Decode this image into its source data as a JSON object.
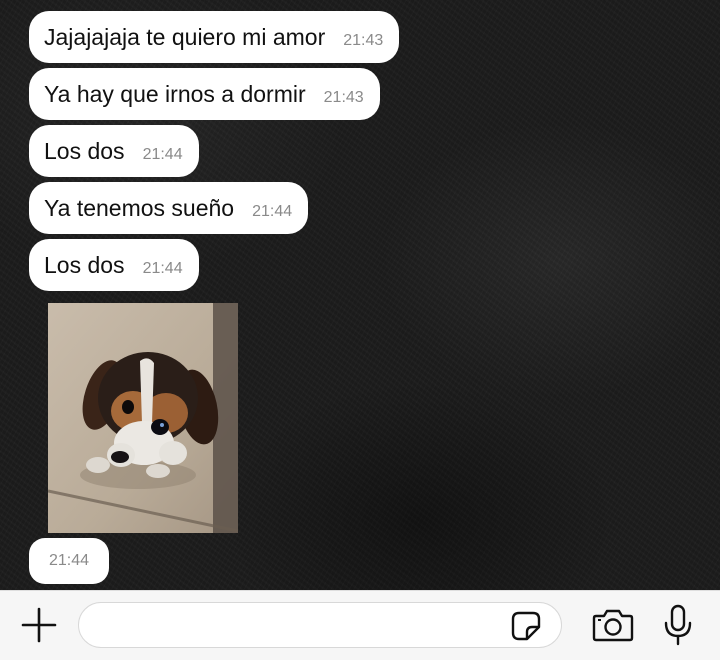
{
  "messages": [
    {
      "text": "Jajajajaja te quiero mi amor",
      "time": "21:43"
    },
    {
      "text": "Ya hay que irnos a dormir",
      "time": "21:43"
    },
    {
      "text": "Los dos",
      "time": "21:44"
    },
    {
      "text": "Ya tenemos sueño",
      "time": "21:44"
    },
    {
      "text": "Los dos",
      "time": "21:44"
    }
  ],
  "photo_message": {
    "subject": "beagle puppy photo",
    "time": "21:44"
  },
  "input_bar": {
    "placeholder": "",
    "icons": [
      "plus-icon",
      "sticker-icon",
      "camera-icon",
      "microphone-icon"
    ]
  },
  "colors": {
    "bubble": "#ffffff",
    "time_text": "#8a8a8a",
    "chat_background": "#1c1c1c",
    "input_bar": "#f6f6f6"
  }
}
